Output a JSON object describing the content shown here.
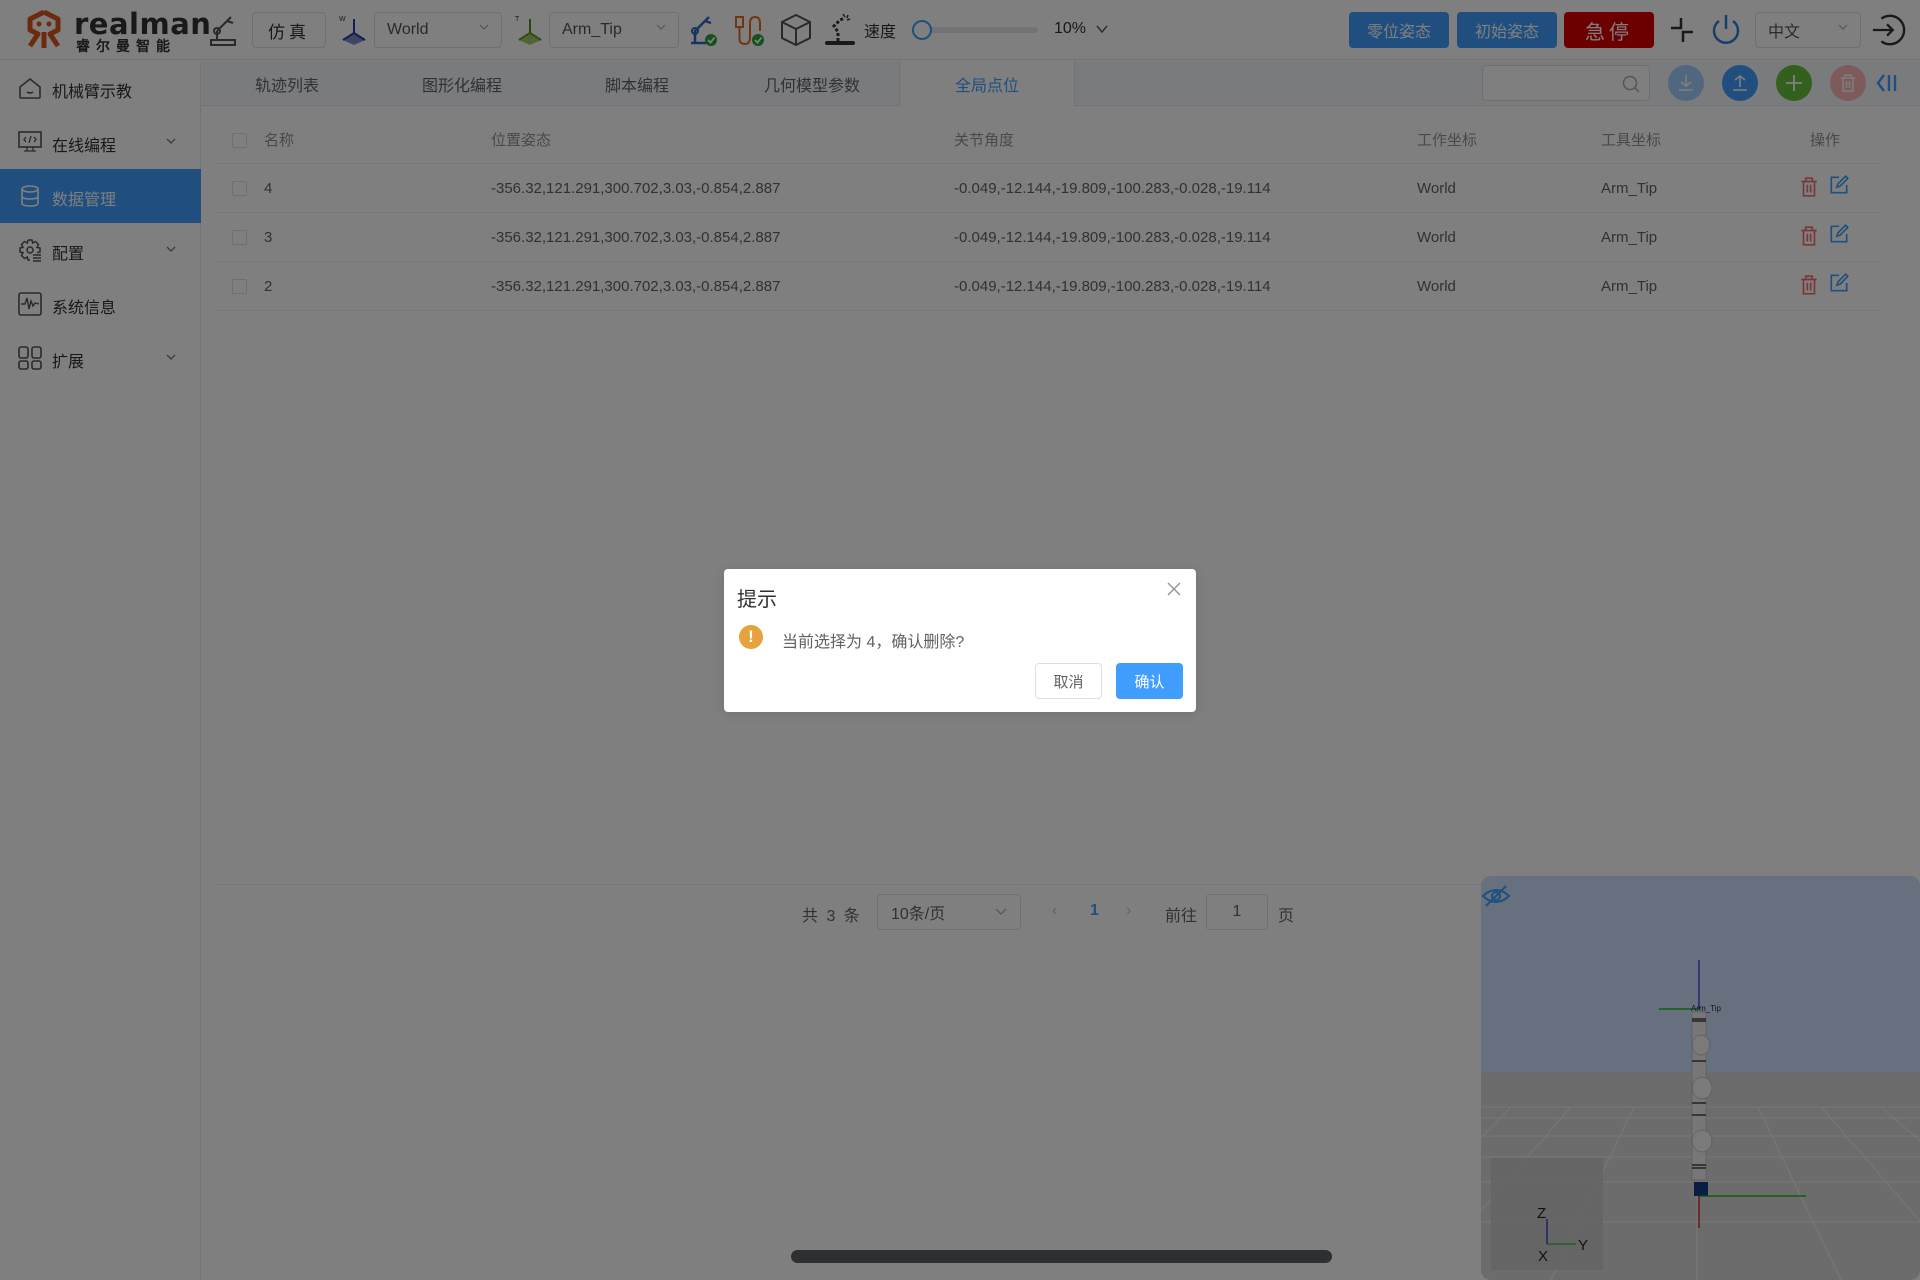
{
  "brand": {
    "name_en": "realman",
    "name_cn": "睿尔曼智能",
    "color": "#d9541e"
  },
  "toolbar": {
    "sim_label": "仿真",
    "work_frame": {
      "badge": "W",
      "value": "World"
    },
    "tool_frame": {
      "badge": "T",
      "value": "Arm_Tip"
    },
    "speed_label": "速度",
    "speed_percent": 10,
    "speed_display": "10%",
    "zero_pose_label": "零位姿态",
    "init_pose_label": "初始姿态",
    "estop_label": "急停",
    "language": "中文",
    "icons": [
      "robot-arm-icon",
      "coordinate-frame-icon",
      "tool-frame-icon",
      "arm-connected-icon",
      "controller-connected-icon",
      "cube-icon",
      "teach-icon",
      "collapse-icon",
      "power-icon",
      "logout-icon"
    ]
  },
  "sidebar": {
    "items": [
      {
        "label": "机械臂示教",
        "icon": "home-icon",
        "expandable": false,
        "active": false
      },
      {
        "label": "在线编程",
        "icon": "code-monitor-icon",
        "expandable": true,
        "active": false
      },
      {
        "label": "数据管理",
        "icon": "database-icon",
        "expandable": false,
        "active": true
      },
      {
        "label": "配置",
        "icon": "gear-icon",
        "expandable": true,
        "active": false
      },
      {
        "label": "系统信息",
        "icon": "pulse-monitor-icon",
        "expandable": false,
        "active": false
      },
      {
        "label": "扩展",
        "icon": "grid-icon",
        "expandable": true,
        "active": false
      }
    ]
  },
  "tabs": [
    {
      "label": "轨迹列表",
      "active": false
    },
    {
      "label": "图形化编程",
      "active": false
    },
    {
      "label": "脚本编程",
      "active": false
    },
    {
      "label": "几何模型参数",
      "active": false
    },
    {
      "label": "全局点位",
      "active": true
    }
  ],
  "search": {
    "value": "",
    "placeholder": ""
  },
  "actions": [
    "download-icon",
    "upload-icon",
    "add-icon",
    "delete-icon",
    "collapse-panel-icon"
  ],
  "table": {
    "headers": {
      "name": "名称",
      "pose": "位置姿态",
      "joints": "关节角度",
      "work_frame": "工作坐标",
      "tool_frame": "工具坐标",
      "ops": "操作"
    },
    "rows": [
      {
        "name": "4",
        "pose": "-356.32,121.291,300.702,3.03,-0.854,2.887",
        "joints": "-0.049,-12.144,-19.809,-100.283,-0.028,-19.114",
        "work_frame": "World",
        "tool_frame": "Arm_Tip"
      },
      {
        "name": "3",
        "pose": "-356.32,121.291,300.702,3.03,-0.854,2.887",
        "joints": "-0.049,-12.144,-19.809,-100.283,-0.028,-19.114",
        "work_frame": "World",
        "tool_frame": "Arm_Tip"
      },
      {
        "name": "2",
        "pose": "-356.32,121.291,300.702,3.03,-0.854,2.887",
        "joints": "-0.049,-12.144,-19.809,-100.283,-0.028,-19.114",
        "work_frame": "World",
        "tool_frame": "Arm_Tip"
      }
    ]
  },
  "pagination": {
    "total_text": "共 3 条",
    "page_size": "10条/页",
    "prev": "‹",
    "current_page": "1",
    "next": "›",
    "goto_label": "前往",
    "goto_value": "1",
    "page_suffix": "页"
  },
  "viewer": {
    "tool_label": "Arm_Tip",
    "axis_labels": {
      "x": "X",
      "y": "Y",
      "z": "Z"
    },
    "colors": {
      "sky": "#cde0ff",
      "floor": "#d8d8d8",
      "x_axis": "#e00000",
      "y_axis": "#00b000",
      "z_axis": "#0000d0"
    }
  },
  "dialog": {
    "title": "提示",
    "message": "当前选择为 4，确认删除?",
    "cancel_label": "取消",
    "confirm_label": "确认",
    "warning_glyph": "!"
  }
}
